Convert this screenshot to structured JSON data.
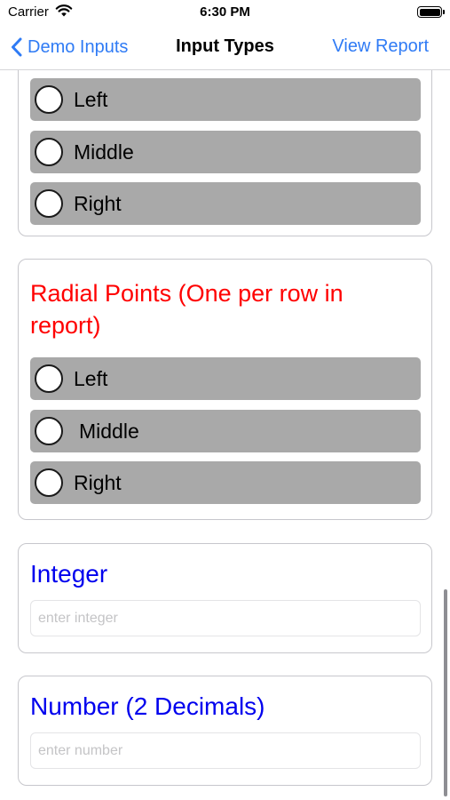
{
  "status_bar": {
    "carrier": "Carrier",
    "time": "6:30 PM",
    "icons": [
      "wifi-icon",
      "battery-icon"
    ]
  },
  "nav": {
    "back_label": "Demo Inputs",
    "title": "Input Types",
    "right_action": "View Report",
    "accent_color": "#2f7bf5"
  },
  "card1": {
    "options": [
      {
        "label": "Left",
        "selected": false
      },
      {
        "label": "Middle",
        "selected": false
      },
      {
        "label": "Right",
        "selected": false
      }
    ]
  },
  "card2": {
    "title": "Radial Points (One per row in report)",
    "title_color": "#ff0000",
    "options": [
      {
        "label": "Left",
        "selected": false
      },
      {
        "label": "Middle",
        "selected": false
      },
      {
        "label": "Right",
        "selected": false
      }
    ]
  },
  "integer_field": {
    "label": "Integer",
    "placeholder": "enter integer",
    "value": "",
    "label_color": "#0000ee"
  },
  "number_field": {
    "label": "Number (2 Decimals)",
    "placeholder": "enter number",
    "value": "",
    "label_color": "#0000ee"
  },
  "colors": {
    "option_row_bg": "#a9a9a9",
    "card_border": "#c7c7cc"
  }
}
